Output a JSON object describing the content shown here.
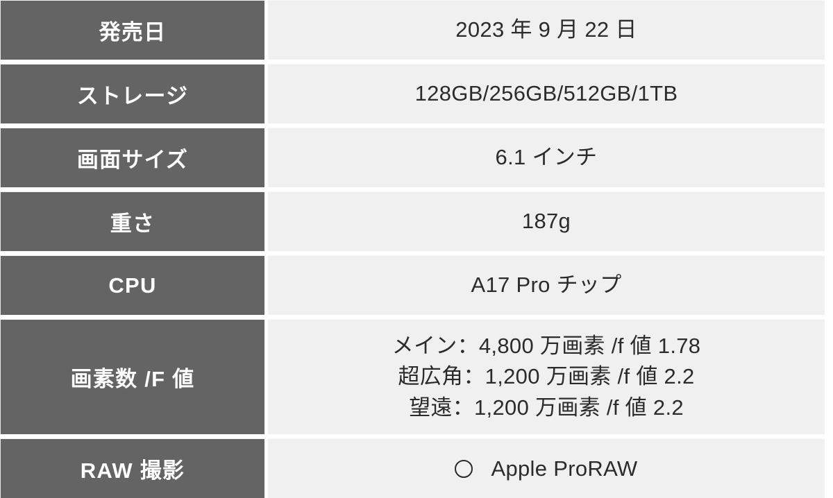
{
  "table": {
    "rows": [
      {
        "label": "発売日",
        "value": "2023 年 9 月 22 日",
        "kind": "single"
      },
      {
        "label": "ストレージ",
        "value": "128GB/256GB/512GB/1TB",
        "kind": "single"
      },
      {
        "label": "画面サイズ",
        "value": "6.1 インチ",
        "kind": "single"
      },
      {
        "label": "重さ",
        "value": "187g",
        "kind": "single"
      },
      {
        "label": "CPU",
        "value": "A17 Pro チップ",
        "kind": "single"
      },
      {
        "label": "画素数 /F 値",
        "kind": "multiline",
        "lines": [
          "メイン：4,800 万画素 /f 値 1.78",
          "超広角：1,200 万画素 /f 値 2.2",
          "望遠：1,200 万画素 /f 値 2.2"
        ]
      },
      {
        "label": "RAW 撮影",
        "kind": "mark",
        "mark_icon": "circle-outline-icon",
        "value": "Apple ProRAW"
      }
    ]
  },
  "colors": {
    "label_background": "#646464",
    "label_text": "#ffffff",
    "value_background": "#f0f0f0",
    "value_text": "#2b2b2b",
    "page_background": "#ffffff"
  }
}
